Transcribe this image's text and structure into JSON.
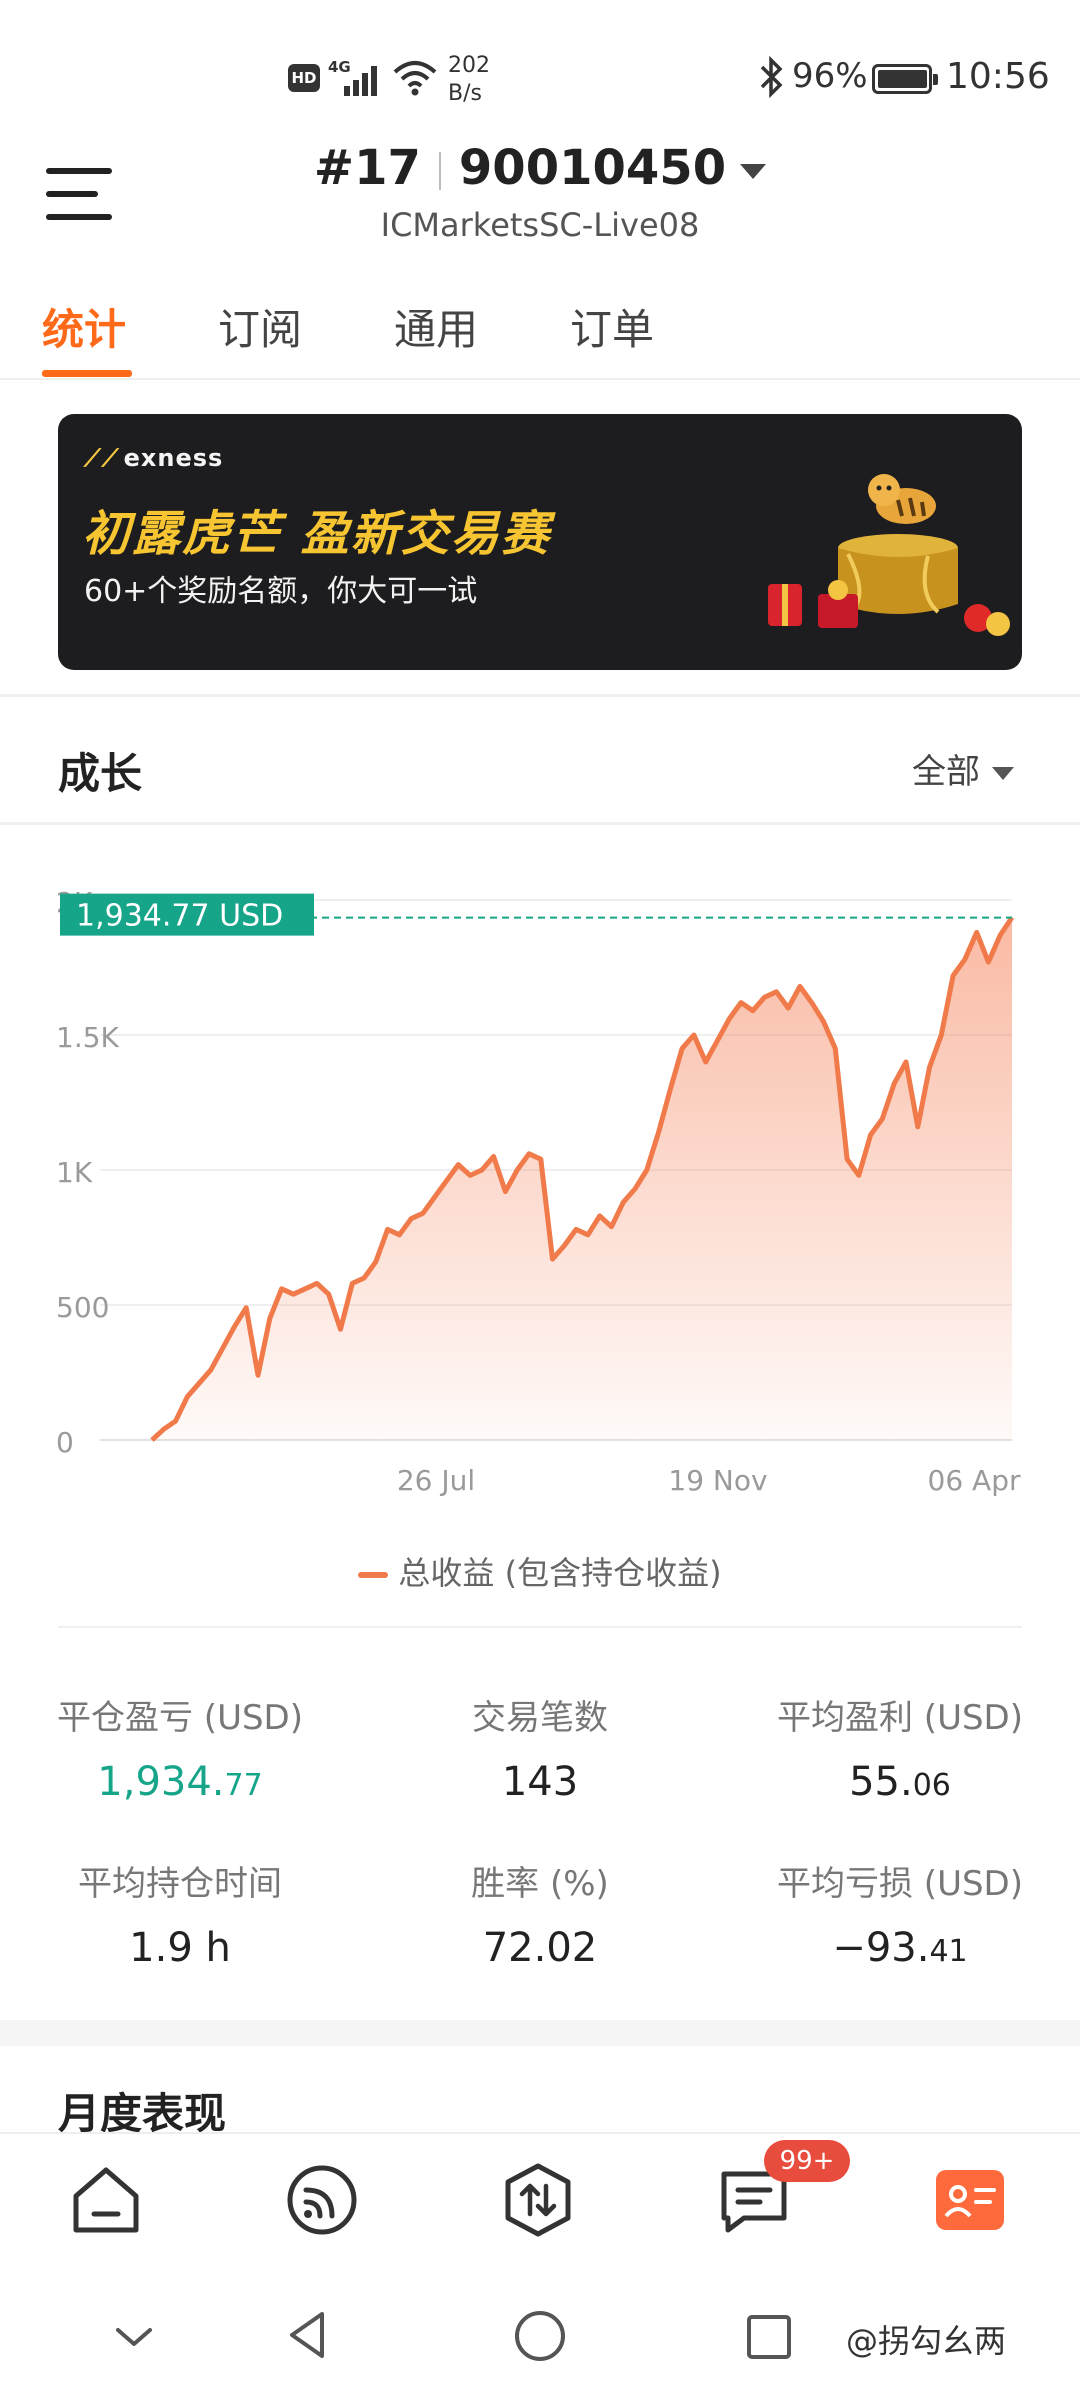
{
  "status_bar": {
    "hd": "HD",
    "network": "4G",
    "speed_value": "202",
    "speed_unit": "B/s",
    "battery": "96%",
    "time": "10:56"
  },
  "header": {
    "account_no": "#17",
    "account_id": "90010450",
    "server": "ICMarketsSC-Live08"
  },
  "tabs": [
    "统计",
    "订阅",
    "通用",
    "订单"
  ],
  "banner": {
    "brand": "exness",
    "title": "初露虎芒 盈新交易赛",
    "subtitle": "60+个奖励名额，你大可一试"
  },
  "growth": {
    "title": "成长",
    "filter": "全部",
    "current_label": "1,934.77 USD",
    "legend": "总收益 (包含持仓收益)"
  },
  "chart_data": {
    "type": "area",
    "y_ticks": [
      "2K",
      "1.5K",
      "1K",
      "500",
      "0"
    ],
    "x_ticks": [
      "26 Jul",
      "19 Nov",
      "06 Apr"
    ],
    "ylim": [
      0,
      2000
    ],
    "current_value": 1934.77,
    "series": [
      {
        "name": "总收益 (包含持仓收益)",
        "values": [
          0,
          40,
          70,
          160,
          210,
          260,
          340,
          420,
          490,
          240,
          450,
          560,
          540,
          560,
          580,
          540,
          410,
          580,
          600,
          660,
          780,
          760,
          820,
          840,
          900,
          960,
          1020,
          980,
          1000,
          1050,
          920,
          1000,
          1060,
          1040,
          670,
          720,
          780,
          760,
          830,
          790,
          880,
          930,
          1000,
          1140,
          1300,
          1450,
          1500,
          1400,
          1480,
          1560,
          1620,
          1590,
          1640,
          1660,
          1600,
          1680,
          1620,
          1550,
          1450,
          1040,
          980,
          1130,
          1190,
          1320,
          1400,
          1160,
          1380,
          1500,
          1720,
          1780,
          1880,
          1770,
          1870,
          1935
        ]
      }
    ],
    "color": "#f07a4a"
  },
  "stats": [
    {
      "label": "平仓盈亏 (USD)",
      "int": "1,934.",
      "dec": "77"
    },
    {
      "label": "交易笔数",
      "int": "143",
      "dec": ""
    },
    {
      "label": "平均盈利 (USD)",
      "int": "55.",
      "dec": "06"
    },
    {
      "label": "平均持仓时间",
      "int": "1.9 h",
      "dec": ""
    },
    {
      "label": "胜率 (%)",
      "int": "72.02",
      "dec": ""
    },
    {
      "label": "平均亏损 (USD)",
      "int": "−93.",
      "dec": "41"
    }
  ],
  "monthly": {
    "title": "月度表现"
  },
  "nav": {
    "badge": "99+"
  },
  "watermark": "@拐勾幺两"
}
